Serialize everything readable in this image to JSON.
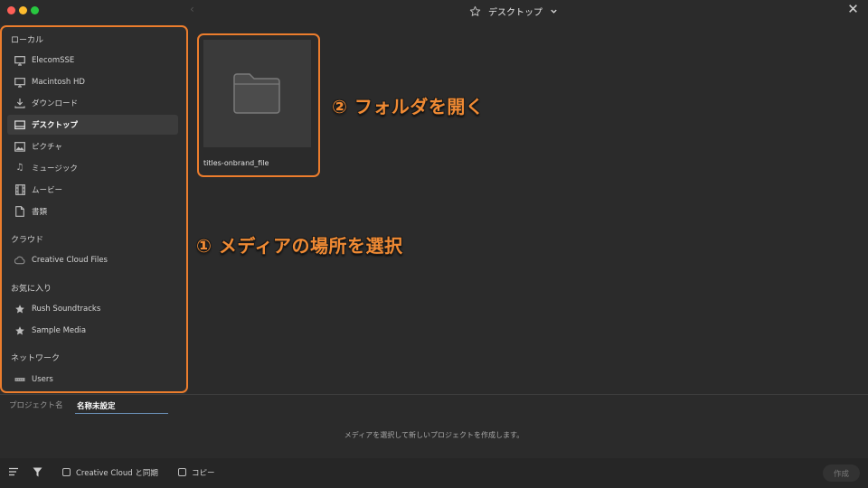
{
  "window": {
    "title": "デスクトップ"
  },
  "sidebar": {
    "sections": [
      {
        "heading": "ローカル"
      },
      {
        "heading": "クラウド"
      },
      {
        "heading": "お気に入り"
      },
      {
        "heading": "ネットワーク"
      }
    ],
    "items": [
      {
        "label": "ElecomSSE",
        "icon": "monitor-icon"
      },
      {
        "label": "Macintosh HD",
        "icon": "monitor-icon"
      },
      {
        "label": "ダウンロード",
        "icon": "download-icon"
      },
      {
        "label": "デスクトップ",
        "icon": "desktop-icon",
        "selected": true
      },
      {
        "label": "ピクチャ",
        "icon": "picture-icon"
      },
      {
        "label": "ミュージック",
        "icon": "music-icon"
      },
      {
        "label": "ムービー",
        "icon": "film-icon"
      },
      {
        "label": "書類",
        "icon": "document-icon"
      },
      {
        "label": "Creative Cloud Files",
        "icon": "creative-cloud-icon"
      },
      {
        "label": "Rush Soundtracks",
        "icon": "star-icon"
      },
      {
        "label": "Sample Media",
        "icon": "star-icon"
      },
      {
        "label": "Users",
        "icon": "network-drive-icon"
      }
    ]
  },
  "main": {
    "folders": [
      {
        "name": "titles-onbrand_file",
        "icon": "folder-icon"
      }
    ]
  },
  "annotations": {
    "step1": "① メディアの場所を選択",
    "step2": "② フォルダを開く"
  },
  "project": {
    "label": "プロジェクト名",
    "name_value": "名称未設定",
    "hint": "メディアを選択して新しいプロジェクトを作成します。"
  },
  "footer": {
    "sync_label": "Creative Cloud と同期",
    "copy_label": "コピー",
    "create_label": "作成"
  },
  "colors": {
    "annotation_accent": "#ec7d2d",
    "background": "#2b2b2b",
    "selected_row": "#3c3c3c"
  }
}
